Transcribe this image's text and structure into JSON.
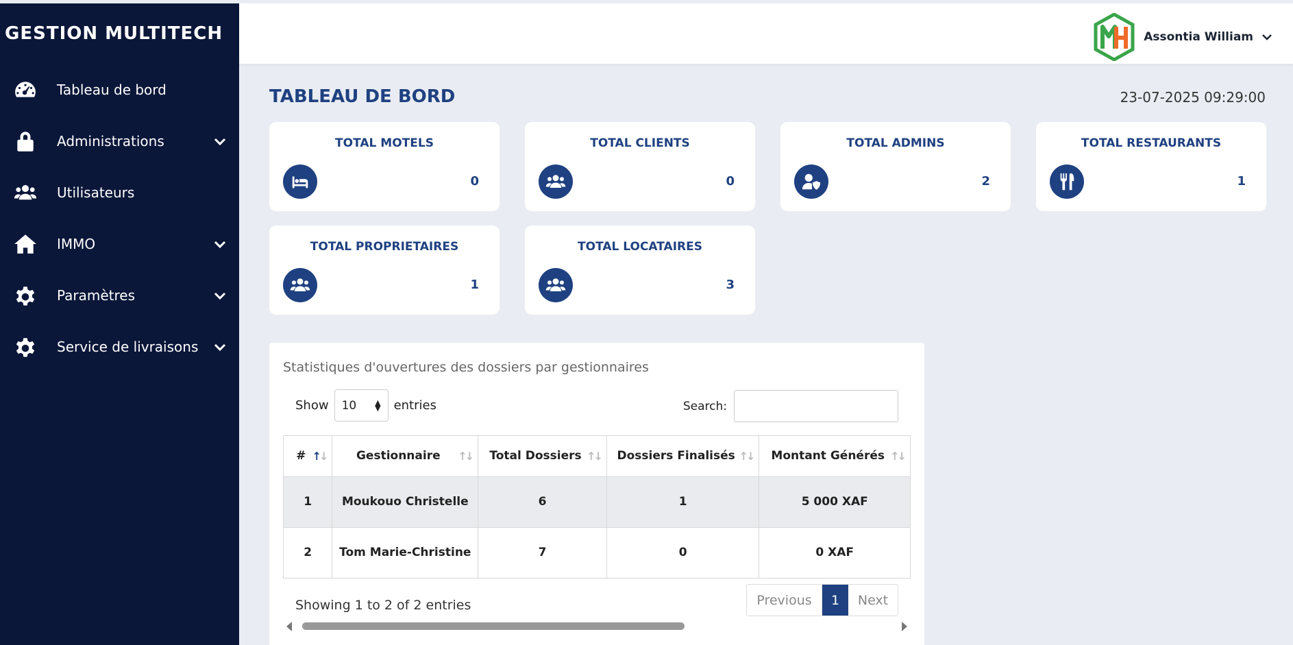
{
  "app": {
    "brand": "GESTION MULTITECH"
  },
  "sidebar": {
    "items": [
      {
        "label": "Tableau de bord",
        "icon": "dashboard-gauge-icon",
        "has_submenu": false
      },
      {
        "label": "Administrations",
        "icon": "lock-icon",
        "has_submenu": true
      },
      {
        "label": "Utilisateurs",
        "icon": "users-icon",
        "has_submenu": false
      },
      {
        "label": "IMMO",
        "icon": "home-icon",
        "has_submenu": true
      },
      {
        "label": "Paramètres",
        "icon": "gear-icon",
        "has_submenu": true
      },
      {
        "label": "Service de livraisons",
        "icon": "gear-icon",
        "has_submenu": true
      }
    ]
  },
  "header": {
    "user_name": "Assontia William",
    "logo": "MH-logo"
  },
  "main": {
    "title": "TABLEAU DE BORD",
    "datetime": "23-07-2025 09:29:00",
    "cards": [
      {
        "title": "TOTAL MOTELS",
        "value": "0",
        "icon": "bed-icon"
      },
      {
        "title": "TOTAL CLIENTS",
        "value": "0",
        "icon": "users-icon"
      },
      {
        "title": "TOTAL ADMINS",
        "value": "2",
        "icon": "user-shield-icon"
      },
      {
        "title": "TOTAL RESTAURANTS",
        "value": "1",
        "icon": "utensils-icon"
      },
      {
        "title": "TOTAL PROPRIETAIRES",
        "value": "1",
        "icon": "users-icon"
      },
      {
        "title": "TOTAL LOCATAIRES",
        "value": "3",
        "icon": "users-icon"
      }
    ]
  },
  "stats": {
    "title": "Statistiques d'ouvertures des dossiers par gestionnaires",
    "show_label": "Show",
    "entries_value": "10",
    "entries_label": "entries",
    "search_label": "Search:",
    "search_value": "",
    "columns": [
      "#",
      "Gestionnaire",
      "Total Dossiers",
      "Dossiers Finalisés",
      "Montant Générés"
    ],
    "rows": [
      [
        "1",
        "Moukouo Christelle",
        "6",
        "1",
        "5 000 XAF"
      ],
      [
        "2",
        "Tom Marie-Christine",
        "7",
        "0",
        "0 XAF"
      ]
    ],
    "info": "Showing 1 to 2 of 2 entries",
    "pager": {
      "previous": "Previous",
      "current": "1",
      "next": "Next"
    }
  },
  "colors": {
    "sidebar_bg": "#0b1739",
    "accent": "#1f4181",
    "page_bg": "#e9edf3"
  }
}
